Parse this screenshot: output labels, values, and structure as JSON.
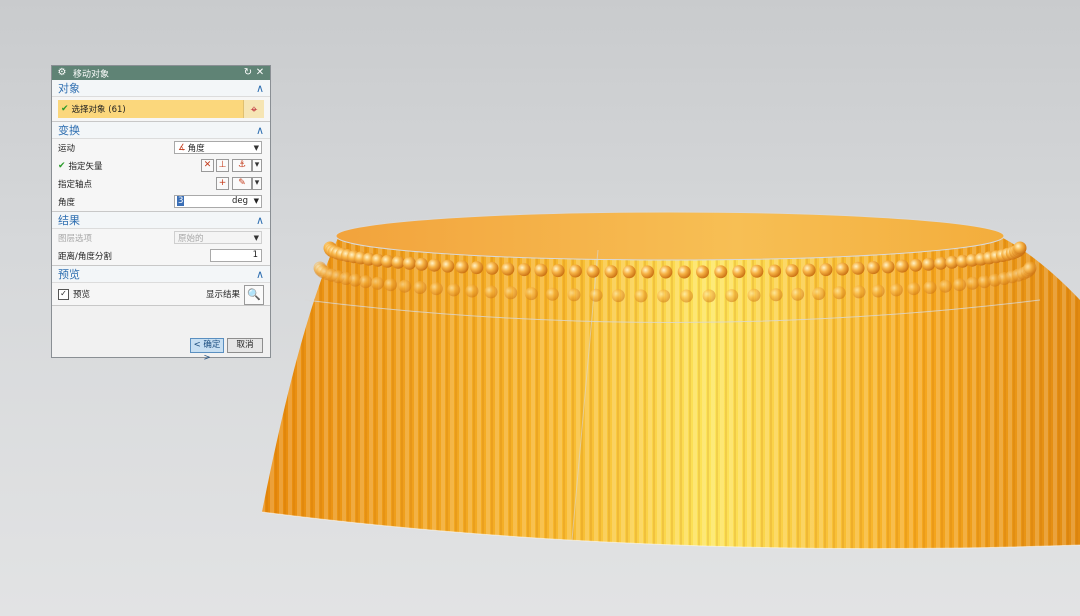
{
  "dialog": {
    "title": "移动对象",
    "icons": {
      "settings": "gear-icon",
      "reset": "reset-icon",
      "close": "close-icon"
    },
    "sections": {
      "object": {
        "header": "对象",
        "select_label": "选择对象 (61)"
      },
      "transform": {
        "header": "变换",
        "motion_label": "运动",
        "motion_value": "角度",
        "vector_label": "指定矢量",
        "pivot_label": "指定轴点",
        "angle_label": "角度",
        "angle_value": "3",
        "angle_unit": "deg"
      },
      "result": {
        "header": "结果",
        "layer_label": "图层选项",
        "layer_value": "原始的",
        "divisions_label": "距离/角度分割",
        "divisions_value": "1"
      },
      "preview": {
        "header": "预览",
        "preview_label": "预览",
        "preview_checked": true,
        "show_result_label": "显示结果"
      }
    },
    "buttons": {
      "ok": "< 确定 >",
      "cancel": "取消"
    }
  },
  "colors": {
    "title_bar": "#5f8375",
    "section_header": "#2f6fb1",
    "selection_highlight": "#fbd77c",
    "model_orange": "#f5a41c"
  }
}
